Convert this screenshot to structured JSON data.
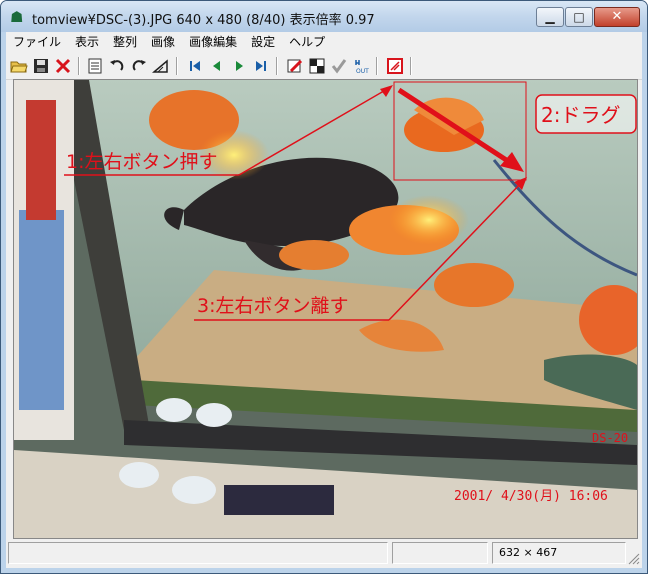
{
  "window": {
    "title": "tomview¥DSC-(3).JPG 640 x 480 (8/40)  表示倍率 0.97",
    "min_glyph": "▁",
    "max_glyph": "□",
    "close_glyph": "✕",
    "app_icon_glyph": "☗"
  },
  "menu": [
    "ファイル",
    "表示",
    "整列",
    "画像",
    "画像編集",
    "設定",
    "ヘルプ"
  ],
  "toolbar": {
    "icons": [
      "open-folder-icon",
      "save-icon",
      "delete-icon",
      "list-icon",
      "rotate-left-icon",
      "rotate-right-icon",
      "flip-icon",
      "first-icon",
      "prev-icon",
      "next-icon",
      "last-icon",
      "edit-icon",
      "grayscale-icon",
      "check-icon",
      "out-icon",
      "properties-icon"
    ]
  },
  "image": {
    "annotations": {
      "step1": "1:左右ボタン押す",
      "step2": "2:ドラグ",
      "step3": "3:左右ボタン離す"
    },
    "camera_id": "DS-20",
    "date_stamp": "2001/ 4/30(月) 16:06",
    "annotation_color": "#e0101a"
  },
  "status": {
    "cell1": "",
    "cell2": "",
    "size": "632 × 467"
  }
}
